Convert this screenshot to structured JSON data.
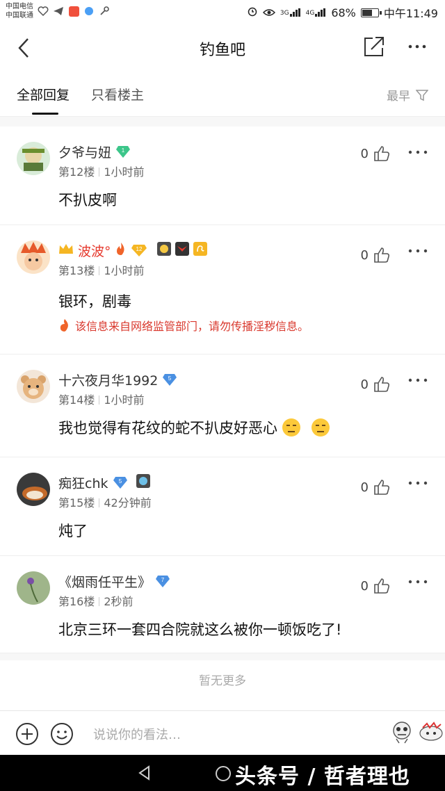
{
  "status_bar": {
    "carrier_1": "中国电信",
    "carrier_2": "中国联通",
    "battery_text": "68%",
    "battery_level": 0.68,
    "time": "中午11:49",
    "network_1": "3G",
    "network_2": "4G"
  },
  "nav": {
    "title": "钓鱼吧",
    "back_icon": "chevron-left-icon",
    "share_icon": "share-icon",
    "more_icon": "more-icon"
  },
  "tabs": {
    "all": "全部回复",
    "owner_only": "只看楼主",
    "sort": "最早",
    "filter_icon": "filter-icon"
  },
  "comments": [
    {
      "name": "夕爷与妞",
      "level": "1",
      "floor": "第12楼",
      "time": "1小时前",
      "body": "不扒皮啊",
      "likes": "0"
    },
    {
      "name": "波波°",
      "level": "12",
      "floor": "第13楼",
      "time": "1小时前",
      "body": "银环，剧毒",
      "likes": "0",
      "warning": "该信息来自网络监管部门，请勿传播淫秽信息。"
    },
    {
      "name": "十六夜月华1992",
      "level": "5",
      "floor": "第14楼",
      "time": "1小时前",
      "body": "我也觉得有花纹的蛇不扒皮好恶心",
      "likes": "0"
    },
    {
      "name": "痴狂chk",
      "level": "5",
      "floor": "第15楼",
      "time": "42分钟前",
      "body": "炖了",
      "likes": "0"
    },
    {
      "name": "《烟雨任平生》",
      "level": "7",
      "floor": "第16楼",
      "time": "2秒前",
      "body": "北京三环一套四合院就这么被你一顿饭吃了!",
      "likes": "0"
    }
  ],
  "no_more": "暂无更多",
  "input": {
    "placeholder": "说说你的看法…"
  },
  "watermark": "头条号 / 哲者理也",
  "colors": {
    "accent_red": "#e63a2e",
    "level_green": "#3cc68a",
    "level_blue": "#4a90e2",
    "level_orange": "#f5b623"
  }
}
